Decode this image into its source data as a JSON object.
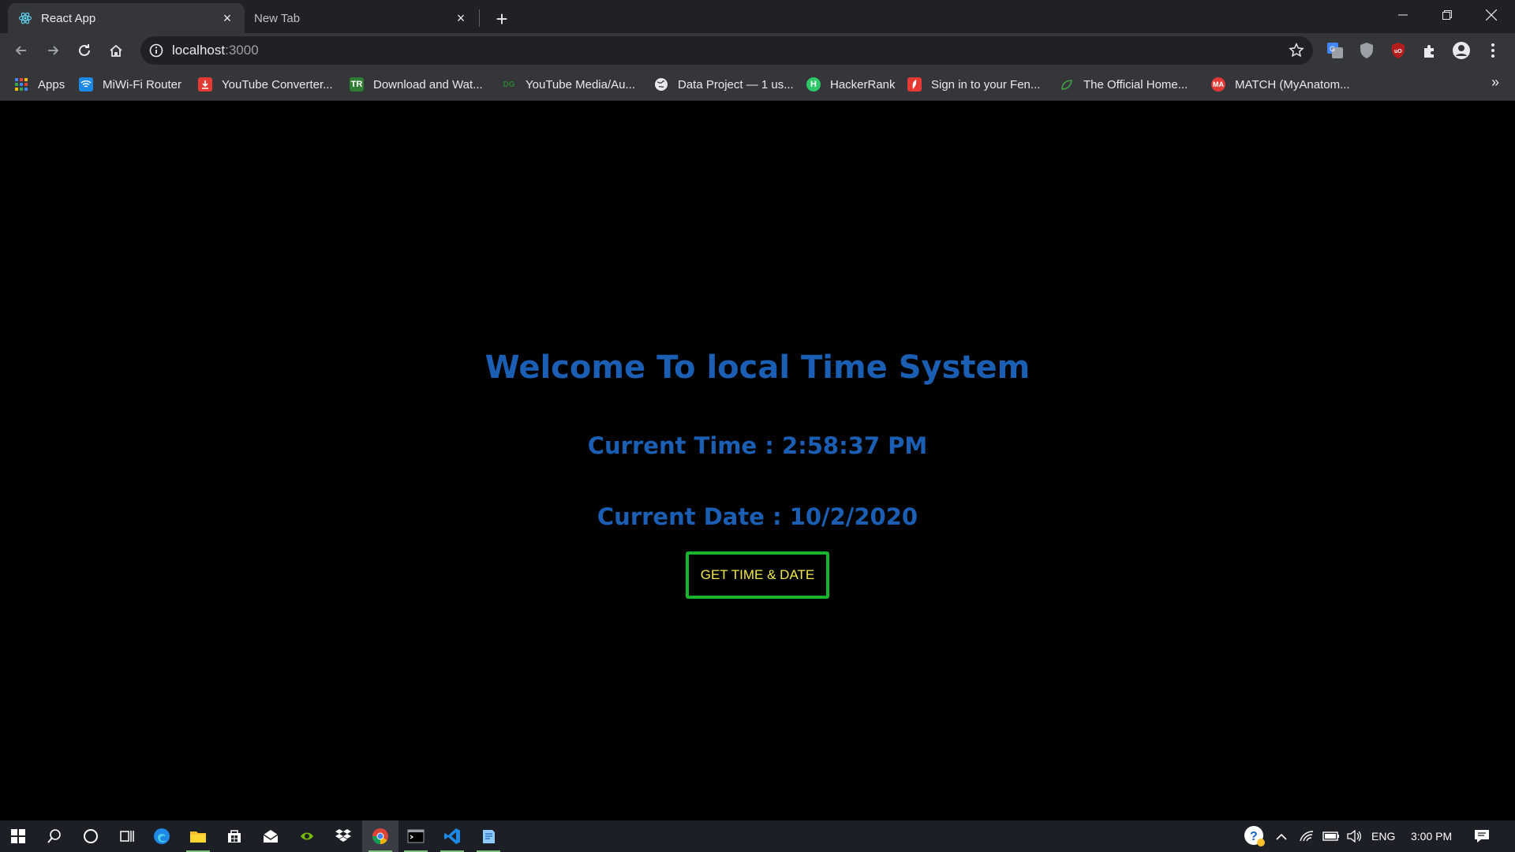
{
  "browser": {
    "tabs": [
      {
        "title": "React App",
        "active": true,
        "icon": "react-icon"
      },
      {
        "title": "New Tab",
        "active": false
      }
    ],
    "address": {
      "host": "localhost",
      "port": ":3000"
    },
    "bookmarks": [
      {
        "label": "Apps",
        "icon": "apps-grid-icon",
        "color": "#4285f4"
      },
      {
        "label": "MiWi-Fi Router",
        "icon": "wifi-icon",
        "color": "#1e88e5"
      },
      {
        "label": "YouTube Converter...",
        "icon": "download-icon",
        "color": "#e53935"
      },
      {
        "label": "Download and Wat...",
        "icon": "tr-icon",
        "color": "#2e7d32"
      },
      {
        "label": "YouTube Media/Au...",
        "icon": "dg-icon",
        "color": "#1b5e20"
      },
      {
        "label": "Data Project — 1 us...",
        "icon": "globe-icon",
        "color": "#e8eaed"
      },
      {
        "label": "HackerRank",
        "icon": "hackerrank-icon",
        "color": "#2ec866"
      },
      {
        "label": "Sign in to your Fen...",
        "icon": "fender-icon",
        "color": "#e53935"
      },
      {
        "label": "The Official Home...",
        "icon": "leaf-icon",
        "color": "#43a047"
      },
      {
        "label": "MATCH (MyAnatom...",
        "icon": "match-icon",
        "color": "#e53935"
      }
    ]
  },
  "page": {
    "heading": "Welcome To local Time System",
    "time_line": "Current Time : 2:58:37 PM",
    "date_line": "Current Date : 10/2/2020",
    "button_label": "GET TIME & DATE"
  },
  "taskbar": {
    "tray": {
      "language": "ENG",
      "clock": "3:00 PM"
    }
  },
  "colors": {
    "heading": "#1a5fb4",
    "button_border": "#18b42b",
    "button_text": "#f0e94a"
  }
}
